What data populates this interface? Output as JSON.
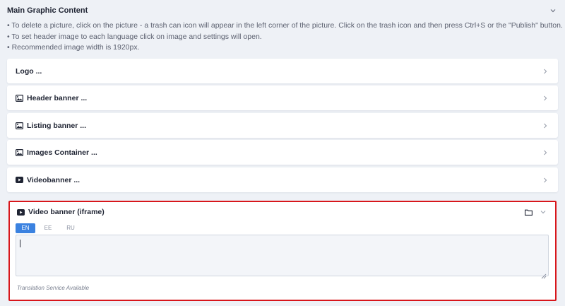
{
  "section": {
    "title": "Main Graphic Content",
    "notes": [
      "• To delete a picture, click on the picture - a trash can icon will appear in the left corner of the picture. Click on the trash icon and then press Ctrl+S or the \"Publish\" button.",
      "• To set header image to each language click on image and settings will open.",
      "• Recommended image width is 1920px."
    ]
  },
  "panels": [
    {
      "label": "Logo ...",
      "icon": ""
    },
    {
      "label": "Header banner ...",
      "icon": "image-icon"
    },
    {
      "label": "Listing banner ...",
      "icon": "image-icon"
    },
    {
      "label": "Images Container ...",
      "icon": "image-icon"
    },
    {
      "label": "Videobanner ...",
      "icon": "video-icon"
    }
  ],
  "video_iframe": {
    "title": "Video banner (iframe)",
    "icon": "video-icon",
    "tabs": [
      "EN",
      "EE",
      "RU"
    ],
    "active_tab": "EN",
    "textarea_value": "",
    "hint": "Translation Service Available"
  },
  "colors": {
    "accent": "#3b82e0",
    "highlight_border": "#d8161b",
    "background": "#eef1f6"
  }
}
